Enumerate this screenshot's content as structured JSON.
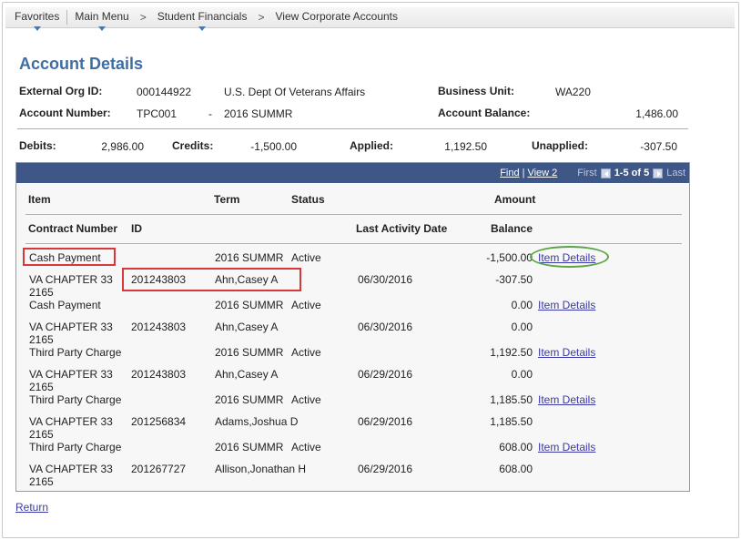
{
  "nav": {
    "favorites": "Favorites",
    "main_menu": "Main Menu",
    "sep": ">",
    "student_financials": "Student Financials",
    "view_corporate_accounts": "View Corporate Accounts"
  },
  "page_title": "Account Details",
  "header": {
    "ext_org_label": "External Org ID:",
    "ext_org_id": "000144922",
    "ext_org_name": "U.S. Dept Of Veterans Affairs",
    "business_unit_label": "Business Unit:",
    "business_unit": "WA220",
    "account_number_label": "Account Number:",
    "account_number": "TPC001",
    "dash": "-",
    "term": "2016 SUMMR",
    "account_balance_label": "Account Balance:",
    "account_balance": "1,486.00"
  },
  "totals": {
    "debits_label": "Debits:",
    "debits": "2,986.00",
    "credits_label": "Credits:",
    "credits": "-1,500.00",
    "applied_label": "Applied:",
    "applied": "1,192.50",
    "unapplied_label": "Unapplied:",
    "unapplied": "-307.50"
  },
  "grid": {
    "find": "Find",
    "sep": "|",
    "view_2": "View 2",
    "first": "First",
    "range": "1-5 of 5",
    "last": "Last",
    "columns": {
      "item": "Item",
      "term": "Term",
      "status": "Status",
      "amount": "Amount",
      "contract_number": "Contract Number",
      "id": "ID",
      "last_activity_date": "Last Activity Date",
      "balance": "Balance"
    },
    "rows": [
      {
        "item": "Cash Payment",
        "term": "2016 SUMMR",
        "status": "Active",
        "amount": "-1,500.00",
        "link": "Item Details",
        "contract_line1": "VA CHAPTER 33",
        "contract_line2": "2165",
        "id": "201243803",
        "name": "Ahn,Casey A",
        "date": "06/30/2016",
        "balance": "-307.50"
      },
      {
        "item": "Cash Payment",
        "term": "2016 SUMMR",
        "status": "Active",
        "amount": "0.00",
        "link": "Item Details",
        "contract_line1": "VA CHAPTER 33",
        "contract_line2": "2165",
        "id": "201243803",
        "name": "Ahn,Casey A",
        "date": "06/30/2016",
        "balance": "0.00"
      },
      {
        "item": "Third Party Charge",
        "term": "2016 SUMMR",
        "status": "Active",
        "amount": "1,192.50",
        "link": "Item Details",
        "contract_line1": "VA CHAPTER 33",
        "contract_line2": "2165",
        "id": "201243803",
        "name": "Ahn,Casey A",
        "date": "06/29/2016",
        "balance": "0.00"
      },
      {
        "item": "Third Party Charge",
        "term": "2016 SUMMR",
        "status": "Active",
        "amount": "1,185.50",
        "link": "Item Details",
        "contract_line1": "VA CHAPTER 33",
        "contract_line2": "2165",
        "id": "201256834",
        "name": "Adams,Joshua D",
        "date": "06/29/2016",
        "balance": "1,185.50"
      },
      {
        "item": "Third Party Charge",
        "term": "2016 SUMMR",
        "status": "Active",
        "amount": "608.00",
        "link": "Item Details",
        "contract_line1": "VA CHAPTER 33",
        "contract_line2": "2165",
        "id": "201267727",
        "name": "Allison,Jonathan H",
        "date": "06/29/2016",
        "balance": "608.00"
      }
    ]
  },
  "return_link": "Return",
  "colors": {
    "title": "#3f6ea3",
    "grid_header": "#3f5786",
    "link": "#3a3aa8",
    "highlight_red": "#d9383a",
    "highlight_green": "#5ba644"
  }
}
